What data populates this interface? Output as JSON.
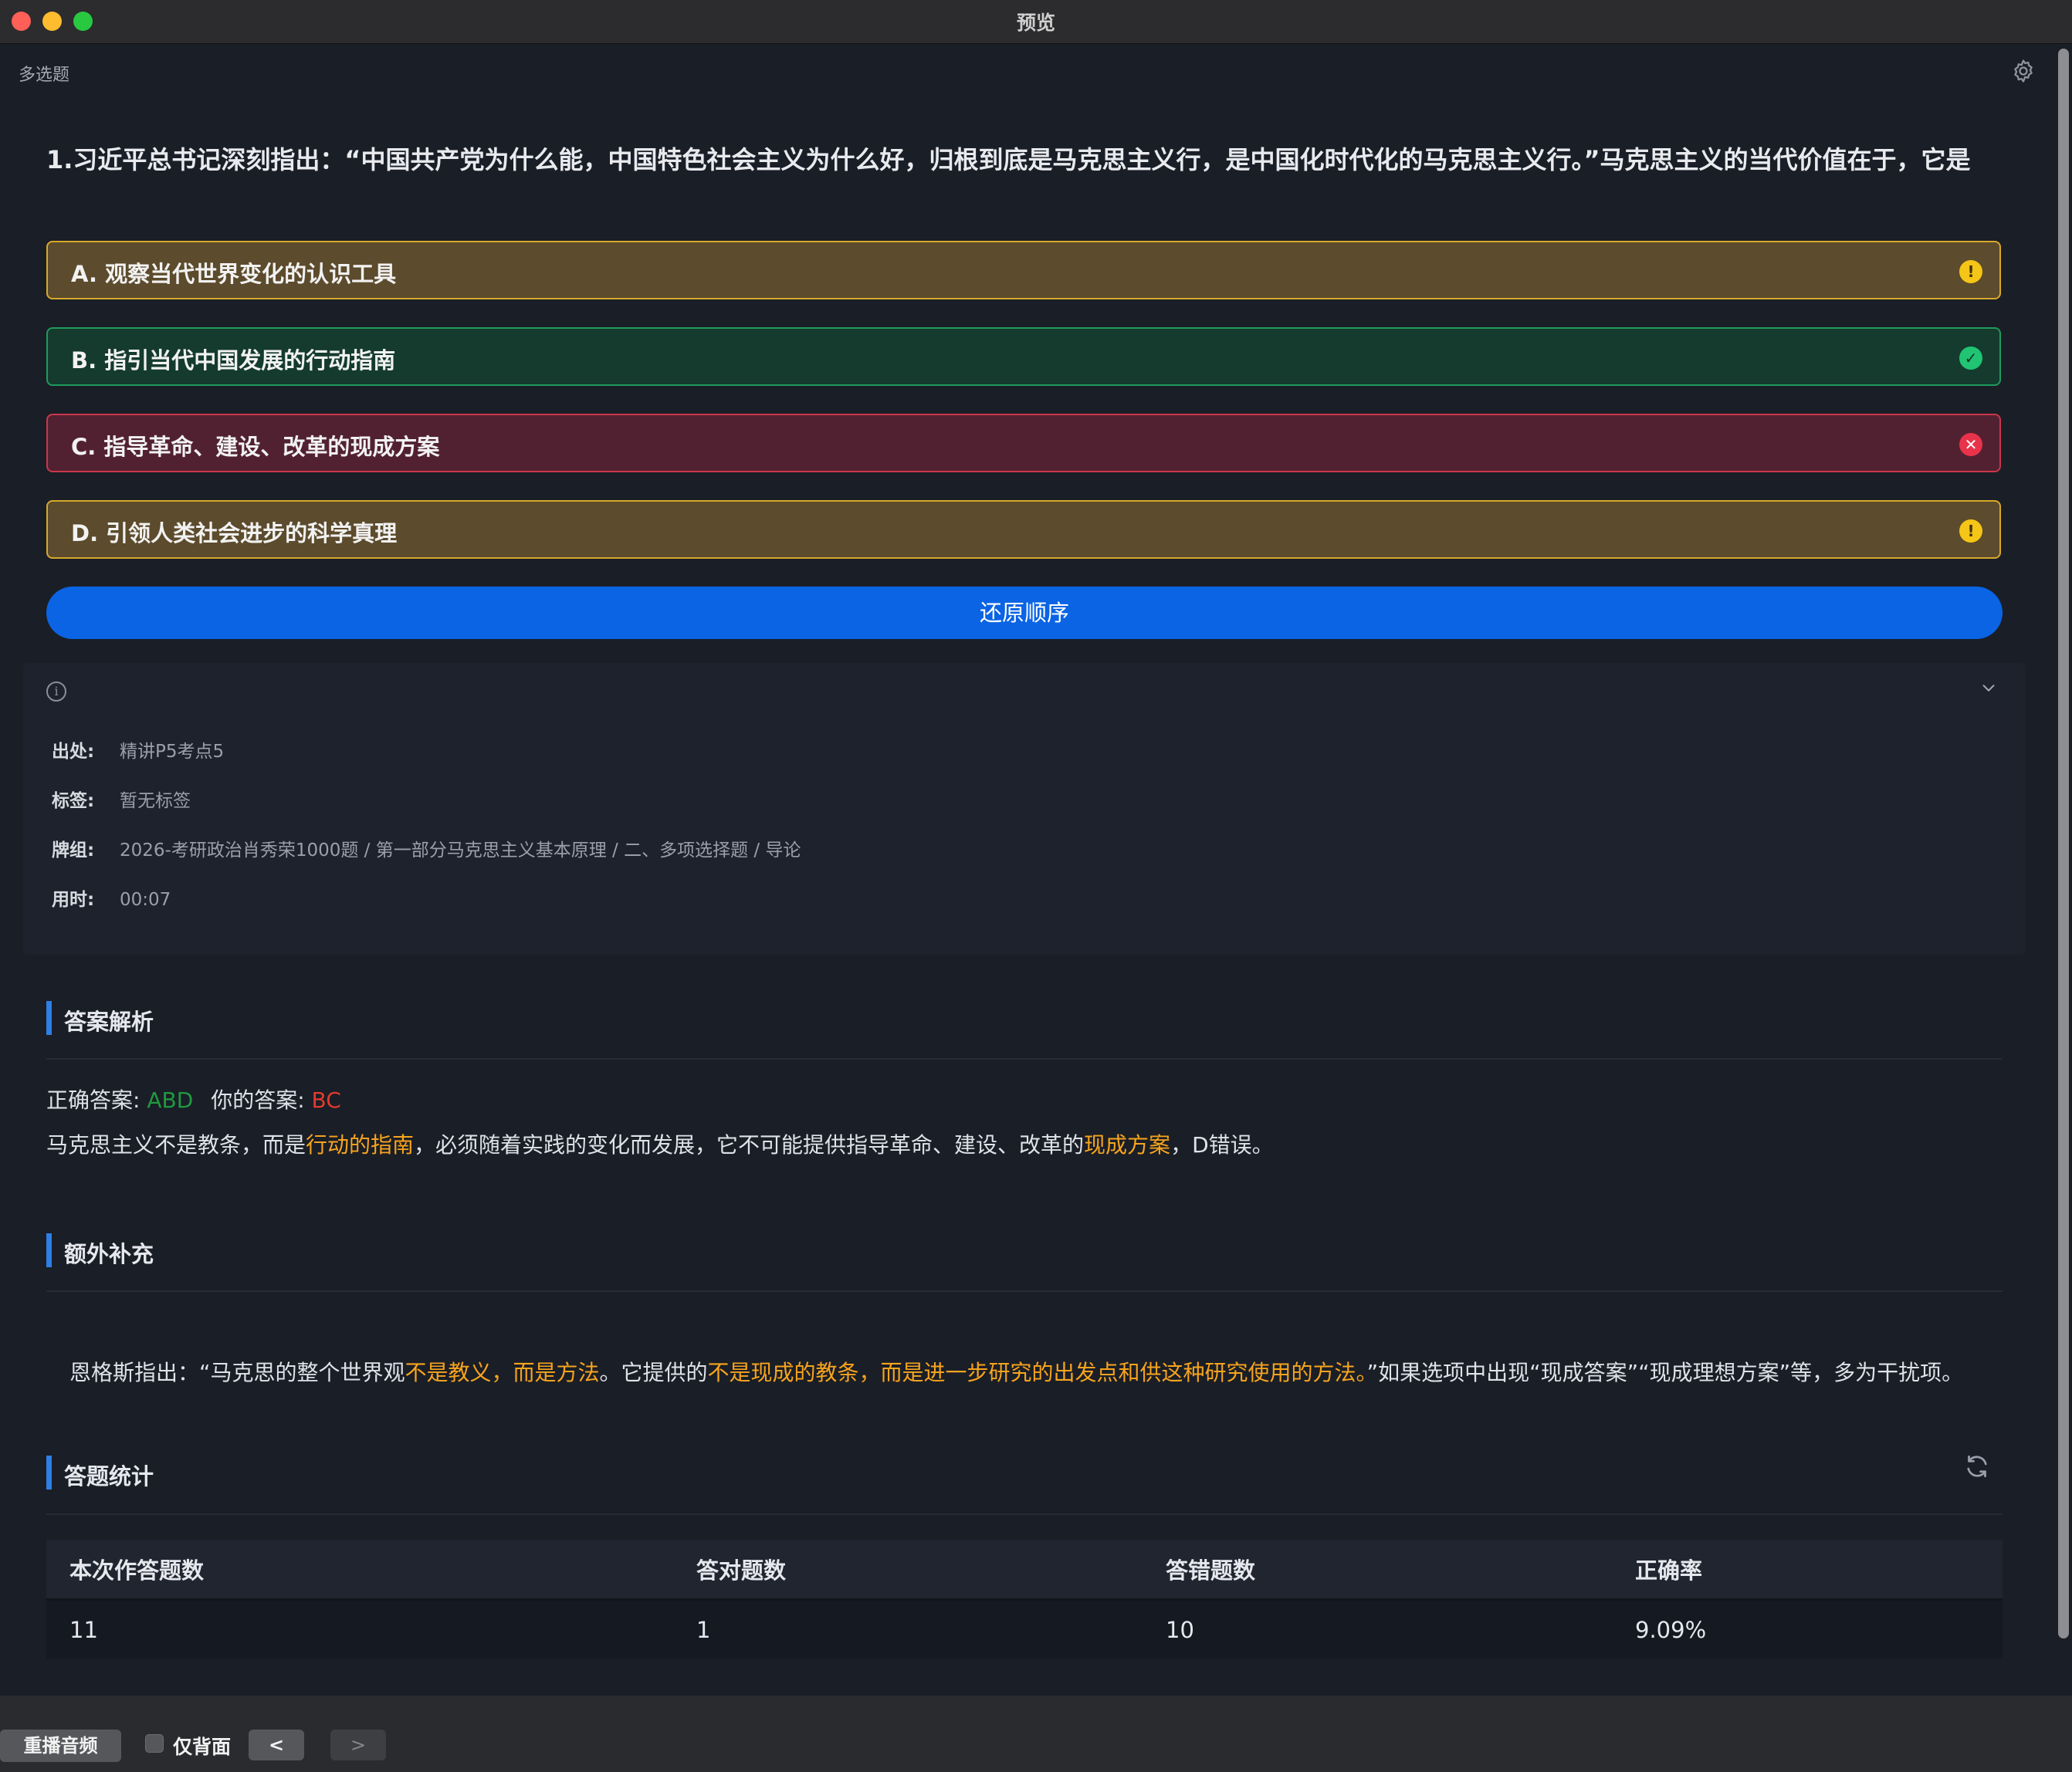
{
  "window": {
    "title": "预览"
  },
  "card": {
    "type_label": "多选题",
    "question": "1.习近平总书记深刻指出：“中国共产党为什么能，中国特色社会主义为什么好，归根到底是马克思主义行，是中国化时代化的马克思主义行。”马克思主义的当代价值在于，它是",
    "options": [
      {
        "label": "A. 观察当代世界变化的认识工具",
        "status": "warning",
        "icon": "exclamation-icon",
        "glyph": "!"
      },
      {
        "label": "B. 指引当代中国发展的行动指南",
        "status": "correct",
        "icon": "check-icon",
        "glyph": "✓"
      },
      {
        "label": "C. 指导革命、建设、改革的现成方案",
        "status": "wrong",
        "icon": "x-icon",
        "glyph": "✕"
      },
      {
        "label": "D. 引领人类社会进步的科学真理",
        "status": "warning",
        "icon": "exclamation-icon",
        "glyph": "!"
      }
    ],
    "restore_button": "还原顺序"
  },
  "info": {
    "icon_glyph": "i",
    "rows": [
      {
        "key": "出处:",
        "value": "精讲P5考点5"
      },
      {
        "key": "标签:",
        "value": "暂无标签"
      },
      {
        "key": "牌组:",
        "value": "2026-考研政治肖秀荣1000题 / 第一部分马克思主义基本原理 / 二、多项选择题 / 导论"
      },
      {
        "key": "用时:",
        "value": "00:07"
      }
    ]
  },
  "analysis": {
    "title": "答案解析",
    "correct_label": "正确答案: ",
    "correct_value": "ABD",
    "user_label": "你的答案: ",
    "user_value": "BC",
    "text_1": "马克思主义不是教条，而是",
    "highlight_1": "行动的指南",
    "text_2": "，必须随着实践的变化而发展，它不可能提供指导革命、建设、改革的",
    "highlight_2": "现成方案",
    "text_3": "，D错误。"
  },
  "extra": {
    "title": "额外补充",
    "text_1": "恩格斯指出：“马克思的整个世界观",
    "highlight_1": "不是教义，而是方法",
    "text_2": "。它提供的",
    "highlight_2": "不是现成的教条，而是进一步研究的出发点和供这种研究使用的方法。",
    "text_3": "”如果选项中出现“现成答案”“现成理想方案”等，多为干扰项。"
  },
  "stats": {
    "title": "答题统计",
    "headers": [
      "本次作答题数",
      "答对题数",
      "答错题数",
      "正确率"
    ],
    "values": [
      "11",
      "1",
      "10",
      "9.09%"
    ]
  },
  "bottom": {
    "replay_label": "重播音频",
    "back_only_label": "仅背面",
    "prev_label": "<",
    "next_label": ">"
  },
  "colors": {
    "accent": "#0a64e4",
    "correct": "#1f9a3e",
    "wrong": "#e33a2d",
    "highlight": "#f7a41d"
  }
}
